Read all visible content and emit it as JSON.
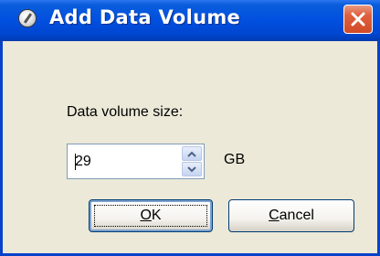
{
  "window": {
    "title": "Add Data Volume",
    "close_icon": "close-icon"
  },
  "form": {
    "size_label": "Data volume size:",
    "size_value": "29",
    "unit": "GB"
  },
  "buttons": {
    "ok_label": "OK",
    "cancel_label": "Cancel"
  },
  "colors": {
    "titlebar": "#0150E0",
    "close_button": "#D14A26",
    "dialog_background": "#ECE9D8"
  }
}
